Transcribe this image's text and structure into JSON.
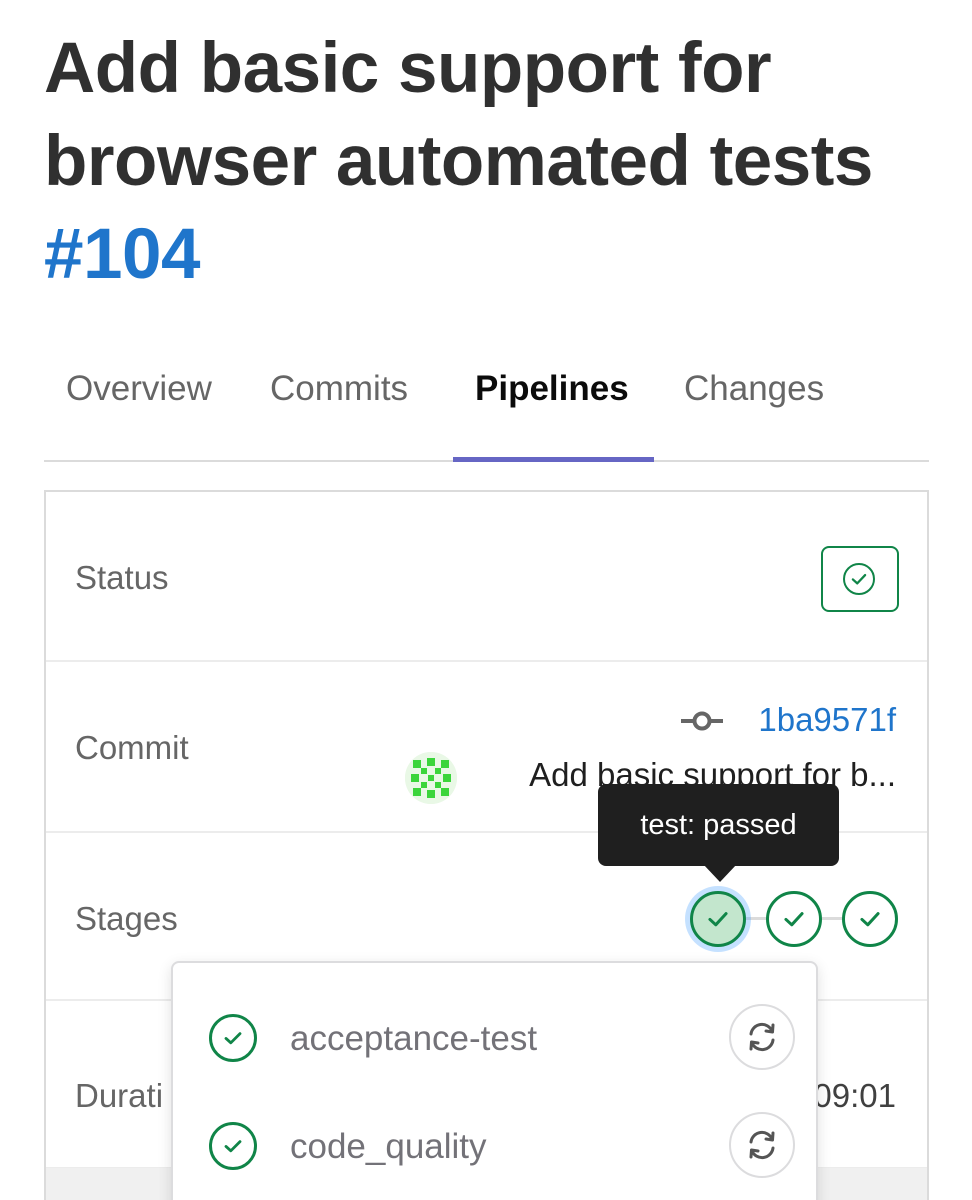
{
  "header": {
    "title": "Add basic support for browser automated tests",
    "mr_id": "#104"
  },
  "tabs": [
    {
      "label": "Overview",
      "active": false
    },
    {
      "label": "Commits",
      "active": false
    },
    {
      "label": "Pipelines",
      "active": true
    },
    {
      "label": "Changes",
      "active": false
    }
  ],
  "pipeline": {
    "status": {
      "label": "Status",
      "icon": "status-success-icon"
    },
    "commit": {
      "label": "Commit",
      "sha": "1ba9571f",
      "message": "Add basic support for b..."
    },
    "stages": {
      "label": "Stages",
      "items": [
        {
          "name": "stage-test",
          "status": "passed",
          "active": true
        },
        {
          "name": "stage-2",
          "status": "passed",
          "active": false
        },
        {
          "name": "stage-3",
          "status": "passed",
          "active": false
        }
      ],
      "tooltip": "test: passed"
    },
    "duration": {
      "label": "Durati",
      "value": "09:01"
    }
  },
  "dropdown": {
    "jobs": [
      {
        "name": "acceptance-test",
        "status": "passed",
        "action": "retry-icon"
      },
      {
        "name": "code_quality",
        "status": "passed",
        "action": "retry-icon"
      }
    ]
  },
  "colors": {
    "success": "#108548",
    "link": "#1f75cb",
    "tab_active_underline": "#6666c4",
    "tooltip_bg": "#1f1f1f"
  }
}
